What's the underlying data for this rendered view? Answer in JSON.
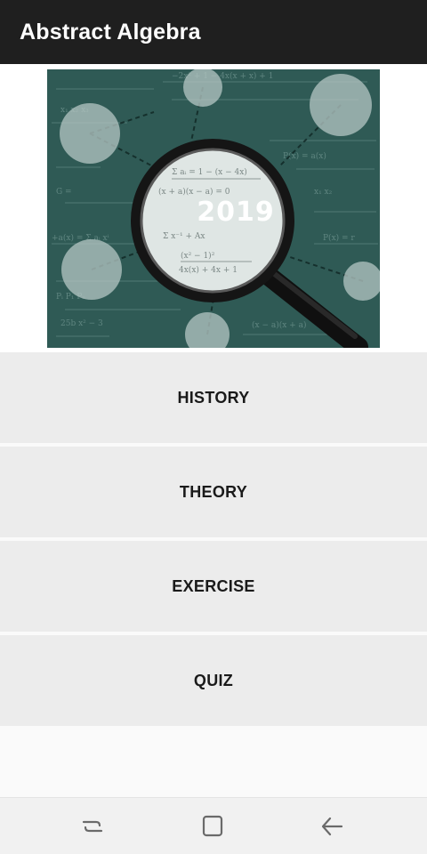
{
  "app_bar": {
    "title": "Abstract Algebra"
  },
  "banner": {
    "year": "2019",
    "image": "magnifying-glass-over-algebra-formulas"
  },
  "menu": {
    "items": [
      {
        "label": "HISTORY"
      },
      {
        "label": "THEORY"
      },
      {
        "label": "EXERCISE"
      },
      {
        "label": "QUIZ"
      }
    ]
  },
  "nav_bar": {
    "icons": [
      "recent-apps-icon",
      "home-icon",
      "back-icon"
    ]
  },
  "colors": {
    "app_bar_bg": "#1f1f1f",
    "button_bg": "#ececec",
    "banner_bg": "#2f5a55"
  }
}
